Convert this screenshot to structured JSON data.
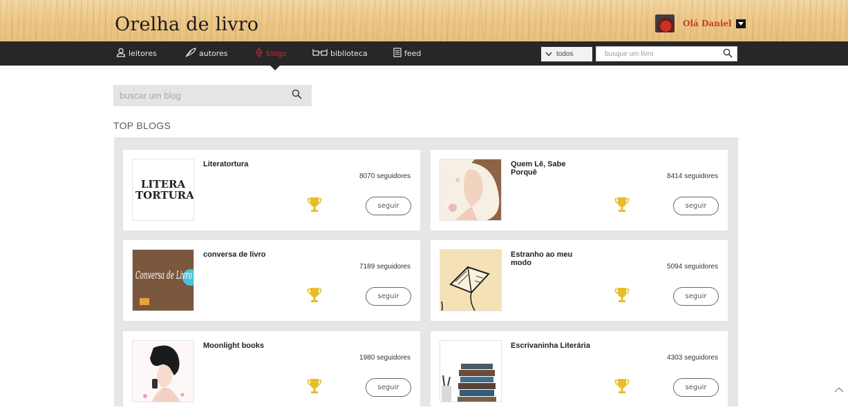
{
  "header": {
    "logo": "Orelha de livro",
    "greeting": "Olá Daniel"
  },
  "nav": {
    "items": [
      {
        "label": "leitores",
        "icon": "person-icon"
      },
      {
        "label": "autores",
        "icon": "quill-icon"
      },
      {
        "label": "blogs",
        "icon": "blog-icon"
      },
      {
        "label": "biblioteca",
        "icon": "glasses-icon"
      },
      {
        "label": "feed",
        "icon": "document-icon"
      }
    ],
    "active": "blogs",
    "filter_label": "todos",
    "search_placeholder": "busque um livro"
  },
  "blog_search": {
    "placeholder": "buscar um blog"
  },
  "section_title": "TOP BLOGS",
  "follow_label": "seguir",
  "blogs": [
    {
      "name": "Literatortura",
      "followers": "8070 seguidores",
      "thumb_text": "LITERA TORTURA"
    },
    {
      "name": "Quem Lê, Sabe Porquê",
      "followers": "8414 seguidores"
    },
    {
      "name": "conversa de livro",
      "followers": "7189 seguidores",
      "thumb_text": "Conversa de Livro"
    },
    {
      "name": "Estranho ao meu modo",
      "followers": "5094 seguidores"
    },
    {
      "name": "Moonlight books",
      "followers": "1980 seguidores"
    },
    {
      "name": "Escrivaninha Literária",
      "followers": "4303 seguidores"
    }
  ],
  "colors": {
    "nav_bg": "#272727",
    "active": "#d0273a",
    "trophy": "#e7be2a",
    "greeting": "#c63b2a"
  }
}
